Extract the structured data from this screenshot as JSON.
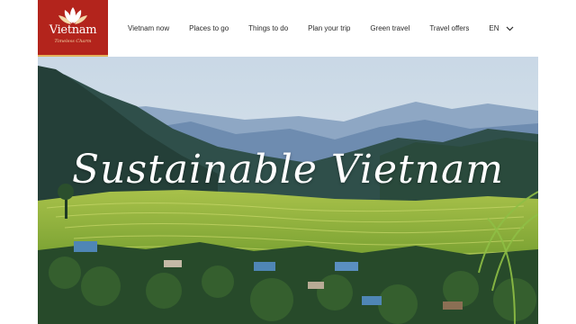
{
  "logo": {
    "brand": "Vietnam",
    "tagline": "Timeless Charm"
  },
  "nav": {
    "items": [
      "Vietnam now",
      "Places to go",
      "Things to do",
      "Plan your trip",
      "Green travel",
      "Travel offers"
    ],
    "language": "EN"
  },
  "hero": {
    "title": "Sustainable Vietnam"
  },
  "colors": {
    "brand_red": "#b3241c",
    "gold_accent": "#e4b15a",
    "nav_text": "#2b2b2b"
  },
  "icons": {
    "logo_mark": "lotus-flower-icon",
    "language_dropdown": "chevron-down-icon"
  }
}
